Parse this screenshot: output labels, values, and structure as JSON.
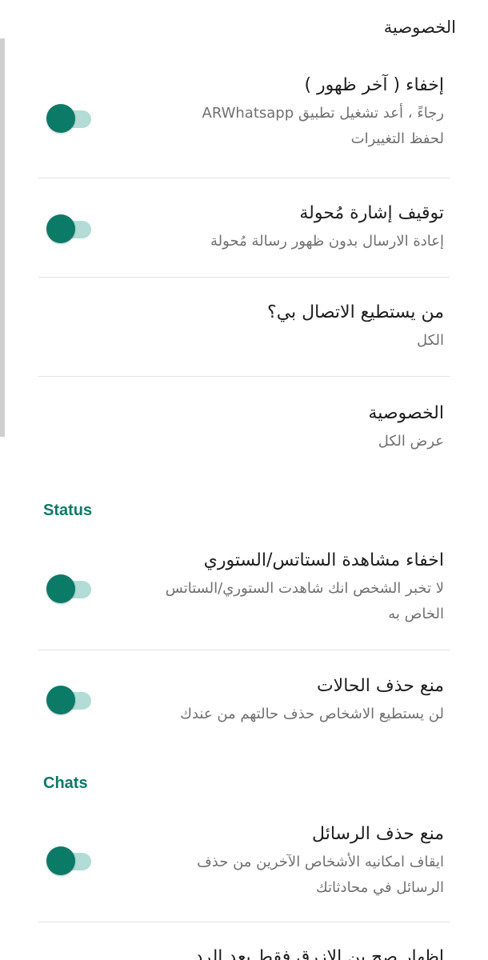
{
  "header": {
    "title": "الخصوصية"
  },
  "sections": {
    "status": "Status",
    "chats": "Chats"
  },
  "items": [
    {
      "title": "إخفاء ( آخر ظهور )",
      "subtitle_line1": "رجاءً ، أعد تشغيل تطبيق ARWhatsapp",
      "subtitle_line2": "لحفظ التغييرات",
      "toggle": "off"
    },
    {
      "title": "توقيف إشارة مُحولة",
      "subtitle_line1": "إعادة الارسال بدون ظهور رسالة مُحولة",
      "toggle": "off"
    },
    {
      "title": "من يستطيع الاتصال بي؟",
      "subtitle_line1": "الكل"
    },
    {
      "title": "الخصوصية",
      "subtitle_line1": "عرض الكل"
    },
    {
      "title": "اخفاء مشاهدة الستاتس/الستوري",
      "subtitle_line1": "لا تخبر الشخص انك شاهدت الستوري/الستاتس",
      "subtitle_line2": "الخاص به",
      "toggle": "off"
    },
    {
      "title": "منع حذف الحالات",
      "subtitle_line1": "لن يستطيع الاشخاص حذف حالتهم من عندك",
      "toggle": "off"
    },
    {
      "title": "منع حذف الرسائل",
      "subtitle_line1": "ايقاف امكانيه الأشخاص الآخرين من حذف",
      "subtitle_line2": "الرسائل في محادثاتك",
      "toggle": "off"
    },
    {
      "title": "اظهار صح بن الازرق فقط بعد الرد"
    }
  ]
}
